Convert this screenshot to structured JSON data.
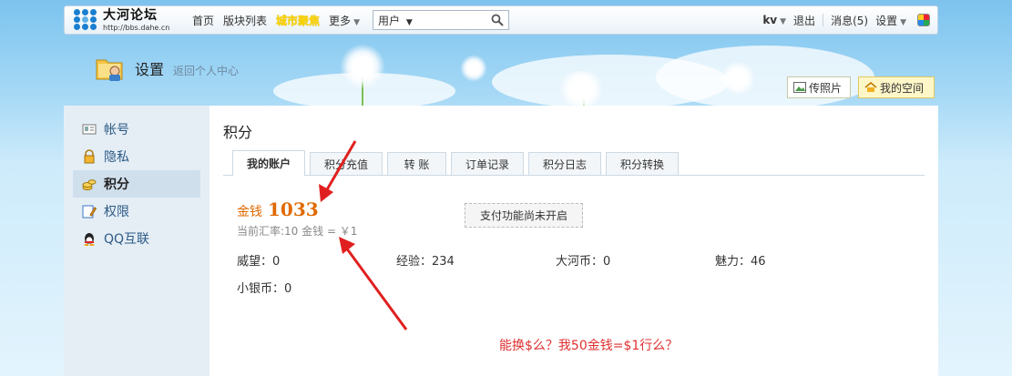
{
  "topbar": {
    "logo_title": "大河论坛",
    "logo_url": "http://bbs.dahe.cn",
    "nav": [
      "首页",
      "版块列表",
      "城市聚焦",
      "更多"
    ],
    "search_type": "用户",
    "user": "kv",
    "logout": "退出",
    "messages": "消息(5)",
    "settings": "设置"
  },
  "header": {
    "title": "设置",
    "back_link": "返回个人中心",
    "upload_photo": "传照片",
    "my_space": "我的空间"
  },
  "sidebar": {
    "items": [
      {
        "label": "帐号",
        "icon": "id-card-icon"
      },
      {
        "label": "隐私",
        "icon": "lock-icon"
      },
      {
        "label": "积分",
        "icon": "coins-icon"
      },
      {
        "label": "权限",
        "icon": "edit-permission-icon"
      },
      {
        "label": "QQ互联",
        "icon": "qq-penguin-icon"
      }
    ],
    "active_index": 2
  },
  "content": {
    "title": "积分",
    "tabs": [
      "我的账户",
      "积分充值",
      "转 账",
      "订单记录",
      "积分日志",
      "积分转换"
    ],
    "active_tab": 0,
    "money_label": "金钱",
    "money_value": "1033",
    "rate_text": "当前汇率:10 金钱 = ￥1",
    "pay_notice": "支付功能尚未开启",
    "stats": [
      {
        "label": "威望",
        "value": "0",
        "text": "威望：0"
      },
      {
        "label": "经验",
        "value": "234",
        "text": "经验：234"
      },
      {
        "label": "大河币",
        "value": "0",
        "text": "大河币：0"
      },
      {
        "label": "魅力",
        "value": "46",
        "text": "魅力：46"
      },
      {
        "label": "小银币",
        "value": "0",
        "text": "小银币：0"
      }
    ]
  },
  "annotation": {
    "note": "能换$么？我50金钱=$1行么？",
    "arrow_color": "#e02020"
  }
}
